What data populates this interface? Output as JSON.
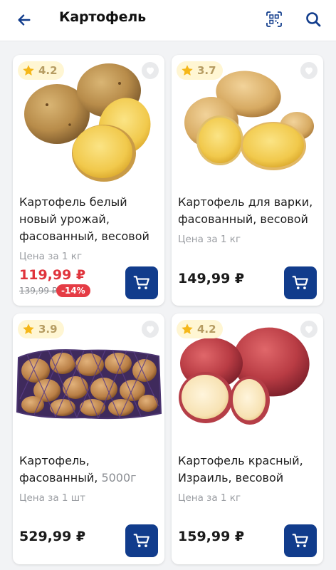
{
  "header": {
    "title": "Картофель",
    "back_icon": "arrow-left-icon",
    "qr_icon": "qr-scan-icon",
    "search_icon": "search-icon"
  },
  "colors": {
    "accent": "#113c8c",
    "sale": "#e0343c",
    "rating_bg": "#fff6d3",
    "star": "#f5b719"
  },
  "products": [
    {
      "rating": "4.2",
      "name": "Картофель белый новый урожай, фасованный, весовой",
      "unit_label": "Цена за 1 кг",
      "price": "119,99 ₽",
      "old_price": "139,99 ₽",
      "discount": "-14%"
    },
    {
      "rating": "3.7",
      "name": "Картофель для варки, фасованный, весовой",
      "unit_label": "Цена за 1 кг",
      "price": "149,99 ₽"
    },
    {
      "rating": "3.9",
      "name_main": "Картофель, фасованный,",
      "name_weight": "5000г",
      "unit_label": "Цена за 1 шт",
      "price": "529,99 ₽"
    },
    {
      "rating": "4.2",
      "name": "Картофель красный, Израиль, весовой",
      "unit_label": "Цена за 1 кг",
      "price": "159,99 ₽"
    }
  ]
}
